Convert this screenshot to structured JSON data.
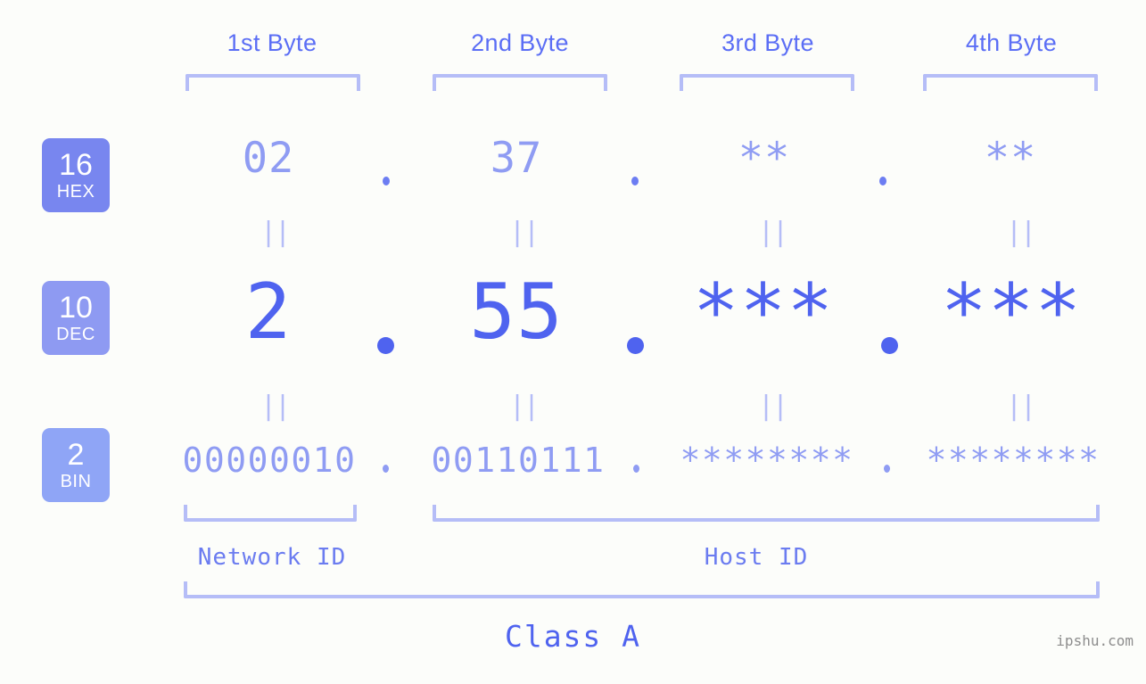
{
  "meta": {
    "background_color": "#fcfdfa",
    "accent_color": "#4f63ef",
    "light_accent_color": "#8f9cf3",
    "bracket_color": "#b5bdf7"
  },
  "byte_headers": [
    {
      "label": "1st Byte"
    },
    {
      "label": "2nd Byte"
    },
    {
      "label": "3rd Byte"
    },
    {
      "label": "4th Byte"
    }
  ],
  "bases": [
    {
      "id": "hex",
      "number": "16",
      "name": "HEX",
      "color": "#7886ef"
    },
    {
      "id": "dec",
      "number": "10",
      "name": "DEC",
      "color": "#8e9af2"
    },
    {
      "id": "bin",
      "number": "2",
      "name": "BIN",
      "color": "#8fa5f6"
    }
  ],
  "rows": {
    "hex": {
      "values": [
        "02",
        "37",
        "**",
        "**"
      ]
    },
    "dec": {
      "values": [
        "2",
        "55",
        "***",
        "***"
      ]
    },
    "bin": {
      "values": [
        "00000010",
        "00110111",
        "********",
        "********"
      ]
    }
  },
  "equals_marks": {
    "glyph": "||",
    "count_per_gap": 4,
    "gaps": 2
  },
  "separators": {
    "hex_dot": ".",
    "dec_dot": ".",
    "bin_dot": "."
  },
  "id_labels": [
    {
      "label": "Network ID"
    },
    {
      "label": "Host ID"
    }
  ],
  "class_label": "Class A",
  "watermark": "ipshu.com"
}
